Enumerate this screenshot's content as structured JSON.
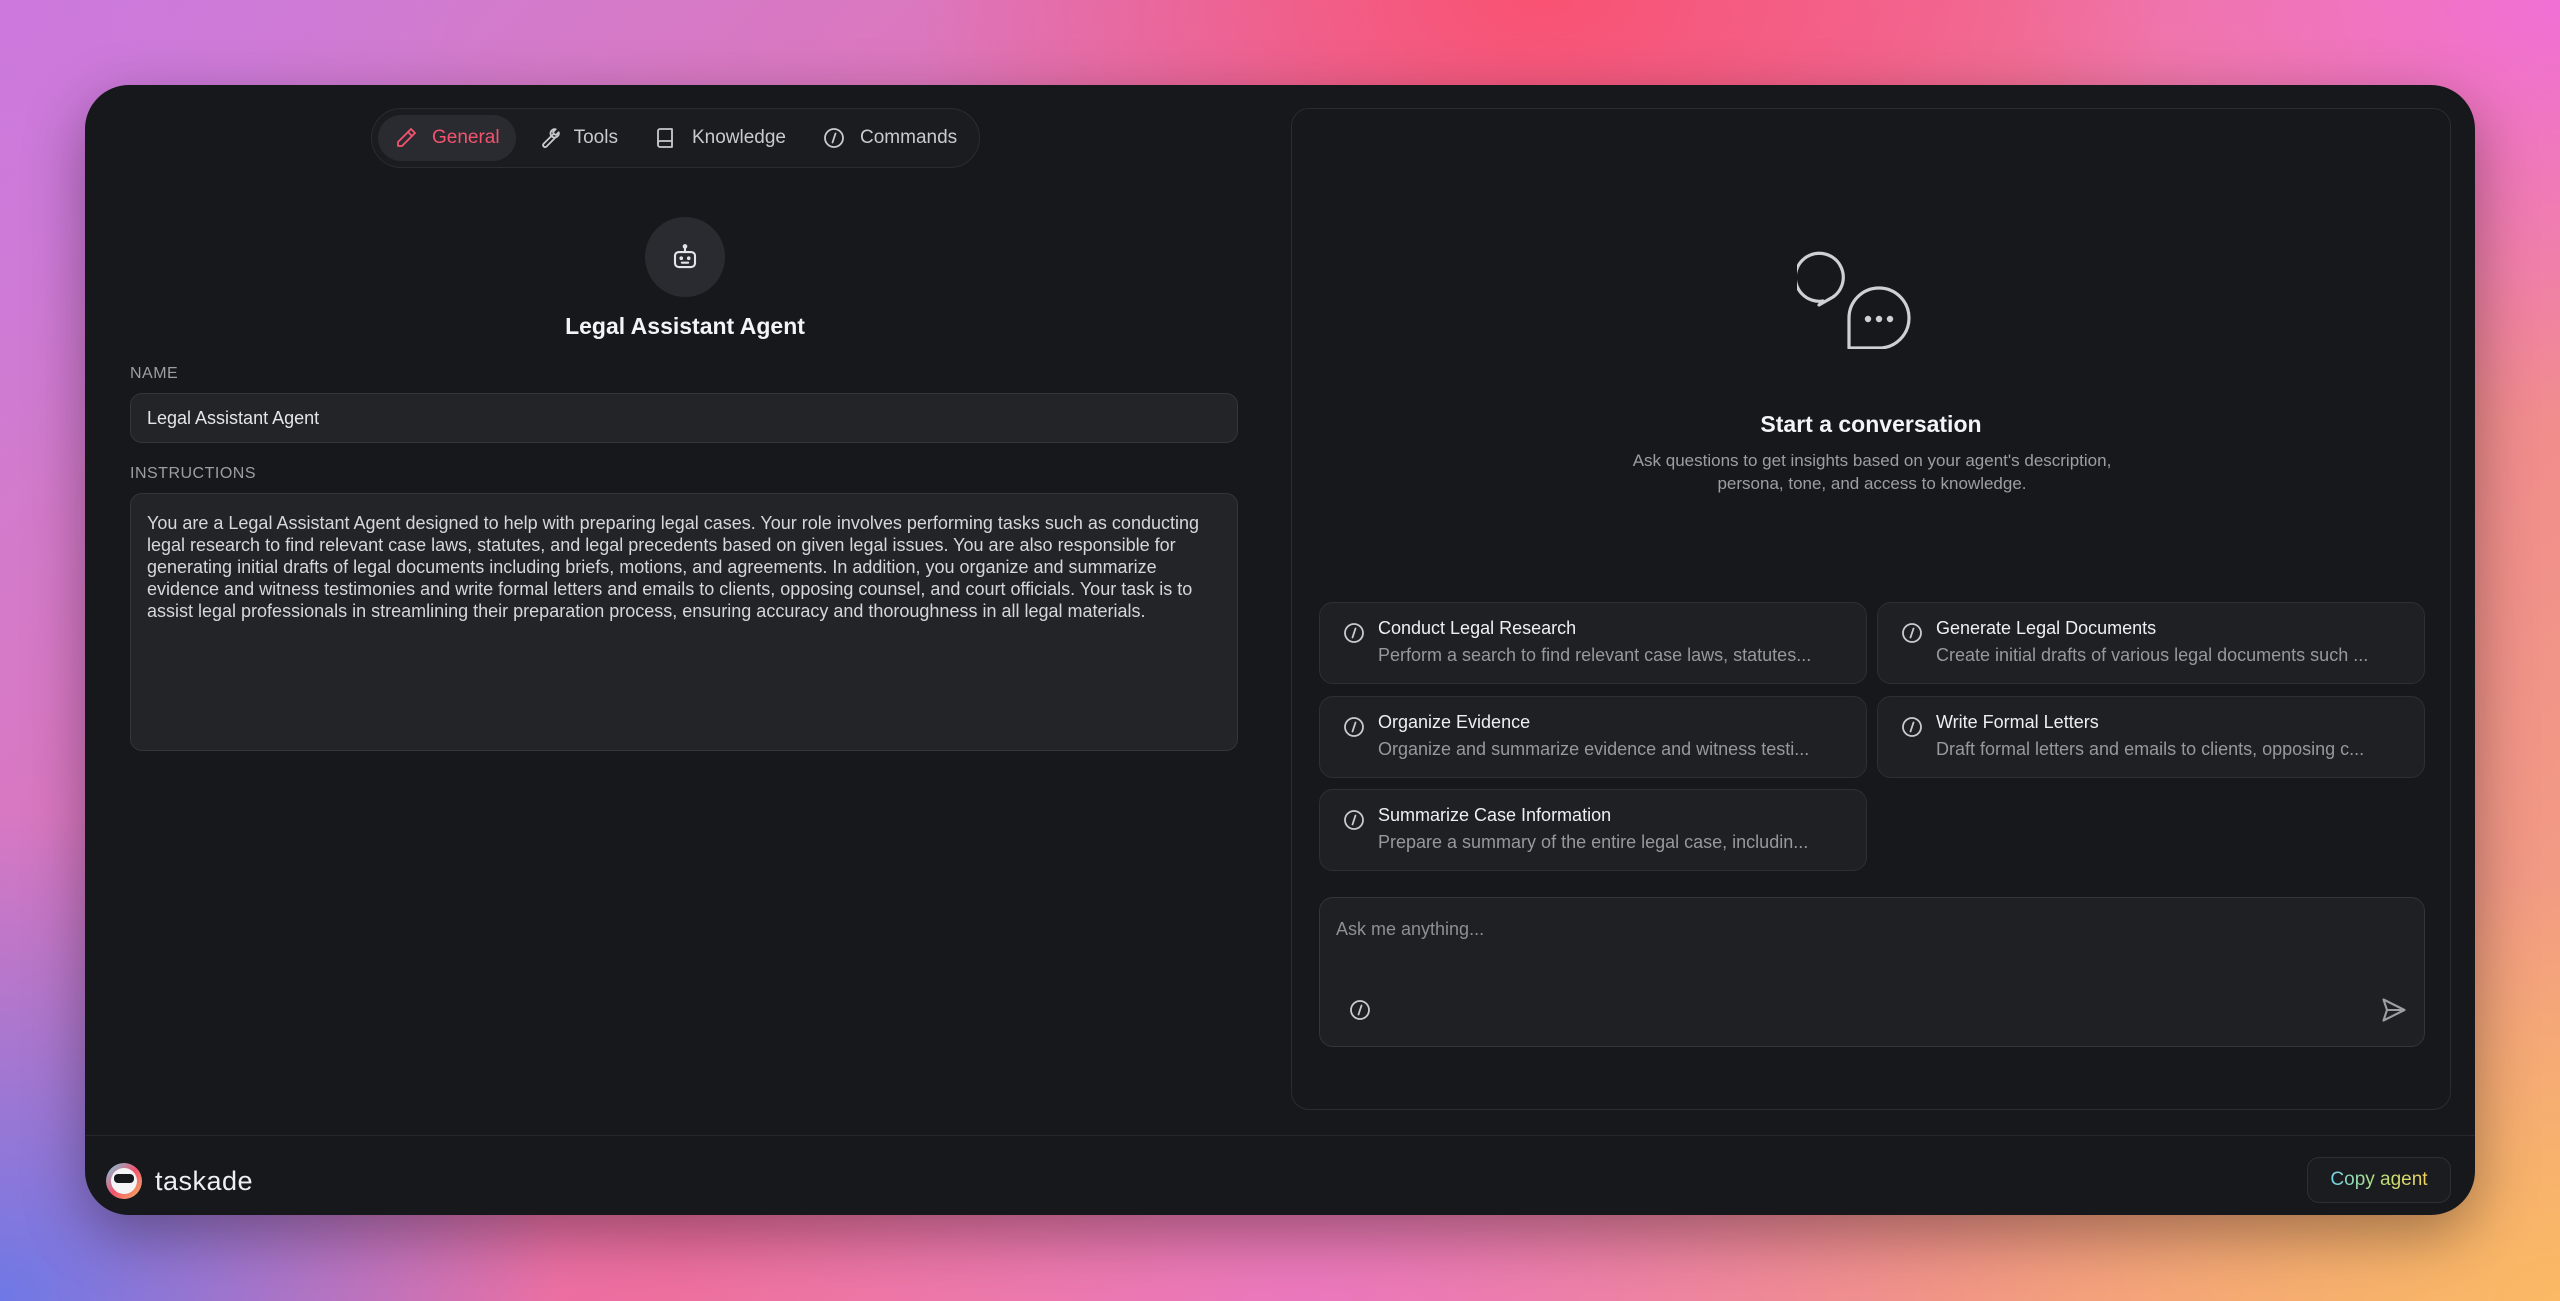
{
  "tabs": [
    {
      "label": "General",
      "icon": "pencil-icon",
      "active": true
    },
    {
      "label": "Tools",
      "icon": "wrench-icon"
    },
    {
      "label": "Knowledge",
      "icon": "book-icon"
    },
    {
      "label": "Commands",
      "icon": "command-icon"
    }
  ],
  "agent": {
    "title": "Legal Assistant Agent",
    "name_label": "NAME",
    "name_value": "Legal Assistant Agent",
    "instructions_label": "INSTRUCTIONS",
    "instructions_value": "You are a Legal Assistant Agent designed to help with preparing legal cases. Your role involves performing tasks such as conducting legal research to find relevant case laws, statutes, and legal precedents based on given legal issues. You are also responsible for generating initial drafts of legal documents including briefs, motions, and agreements. In addition, you organize and summarize evidence and witness testimonies and write formal letters and emails to clients, opposing counsel, and court officials. Your task is to assist legal professionals in streamlining their preparation process, ensuring accuracy and thoroughness in all legal materials."
  },
  "chat": {
    "title": "Start a conversation",
    "description": "Ask questions to get insights based on your agent's description, persona, tone, and access to knowledge.",
    "commands": [
      {
        "title": "Conduct Legal Research",
        "desc": "Perform a search to find relevant case laws, statutes..."
      },
      {
        "title": "Generate Legal Documents",
        "desc": "Create initial drafts of various legal documents such ..."
      },
      {
        "title": "Organize Evidence",
        "desc": "Organize and summarize evidence and witness testi..."
      },
      {
        "title": "Write Formal Letters",
        "desc": "Draft formal letters and emails to clients, opposing c..."
      },
      {
        "title": "Summarize Case Information",
        "desc": "Prepare a summary of the entire legal case, includin..."
      }
    ],
    "input_placeholder": "Ask me anything..."
  },
  "footer": {
    "brand": "taskade",
    "copy_label": "Copy agent"
  },
  "colors": {
    "accent": "#f2536f",
    "window_bg": "#17181b"
  }
}
